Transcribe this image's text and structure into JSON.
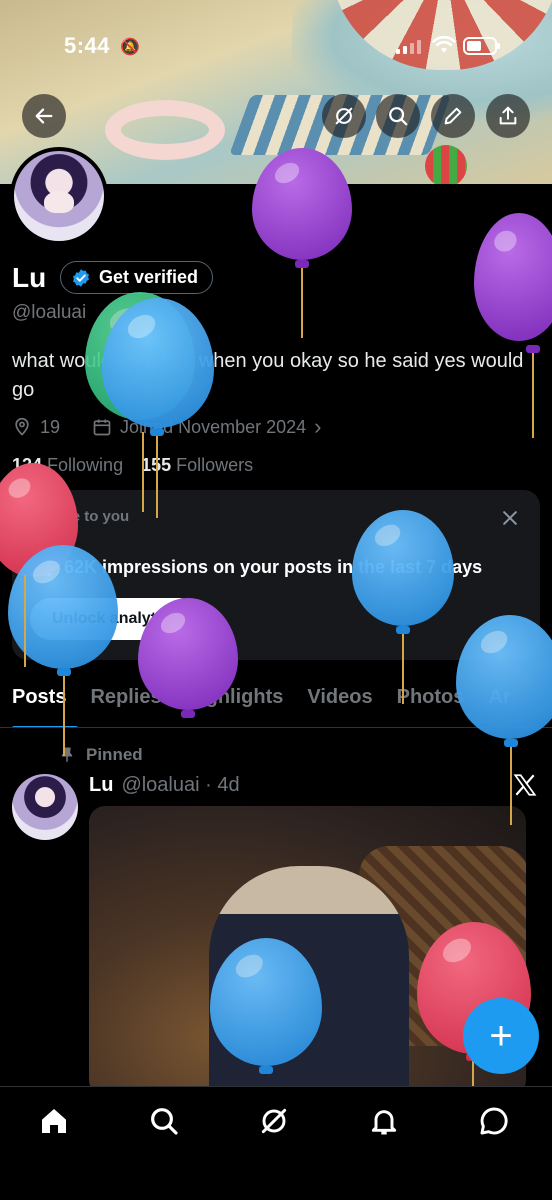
{
  "status_bar": {
    "time": "5:44"
  },
  "profile": {
    "name": "Lu",
    "verify_label": "Get verified",
    "handle": "@loaluai",
    "bio": "what would you do if when you okay so he said yes would go",
    "location": "19",
    "joined": "Joined November 2024",
    "following_count": "124",
    "following_label": "Following",
    "followers_count": "155",
    "followers_label": "Followers"
  },
  "analytics_card": {
    "private_label": "Private to you",
    "impressions_text": "62K impressions on your posts in the last 7 days",
    "unlock_label": "Unlock analytics"
  },
  "tabs": [
    {
      "label": "Posts",
      "active": true
    },
    {
      "label": "Replies"
    },
    {
      "label": "Highlights"
    },
    {
      "label": "Videos"
    },
    {
      "label": "Photos"
    },
    {
      "label": "Ar"
    }
  ],
  "pinned_post": {
    "pinned_label": "Pinned",
    "author": "Lu",
    "handle_time": "@loaluai · 4d"
  },
  "fab_label": "+",
  "colors": {
    "accent": "#1d9bf0",
    "background": "#000000",
    "muted": "#71767b"
  },
  "icons": [
    "back-arrow-icon",
    "grok-icon",
    "search-icon",
    "edit-icon",
    "share-icon",
    "location-icon",
    "calendar-icon",
    "close-icon",
    "analytics-icon",
    "pin-icon",
    "x-logo-icon",
    "home-icon",
    "explore-icon",
    "notifications-icon",
    "messages-icon"
  ]
}
